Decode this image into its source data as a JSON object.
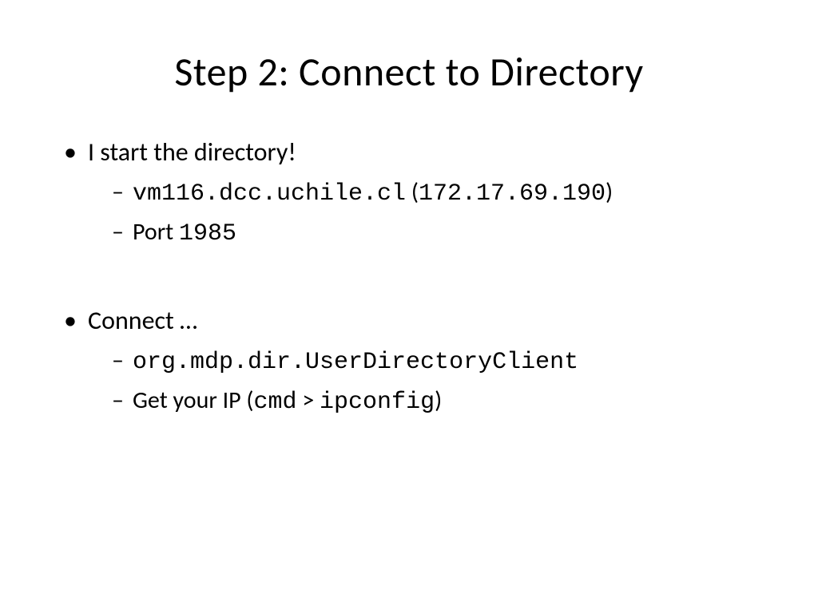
{
  "title": "Step 2: Connect to Directory",
  "b1": {
    "text": "I start the directory!",
    "sub1": {
      "host": "vm116.dcc.uchile.cl",
      "open": " (",
      "ip": "172.17.69.190",
      "close": ")"
    },
    "sub2": {
      "label": "Port ",
      "value": "1985"
    }
  },
  "b2": {
    "text": "Connect …",
    "sub1": {
      "class": "org.mdp.dir.UserDirectoryClient"
    },
    "sub2": {
      "pre": "Get your IP (",
      "cmd": "cmd",
      "gt": " > ",
      "ipconfig": "ipconfig",
      "close": ")"
    }
  }
}
